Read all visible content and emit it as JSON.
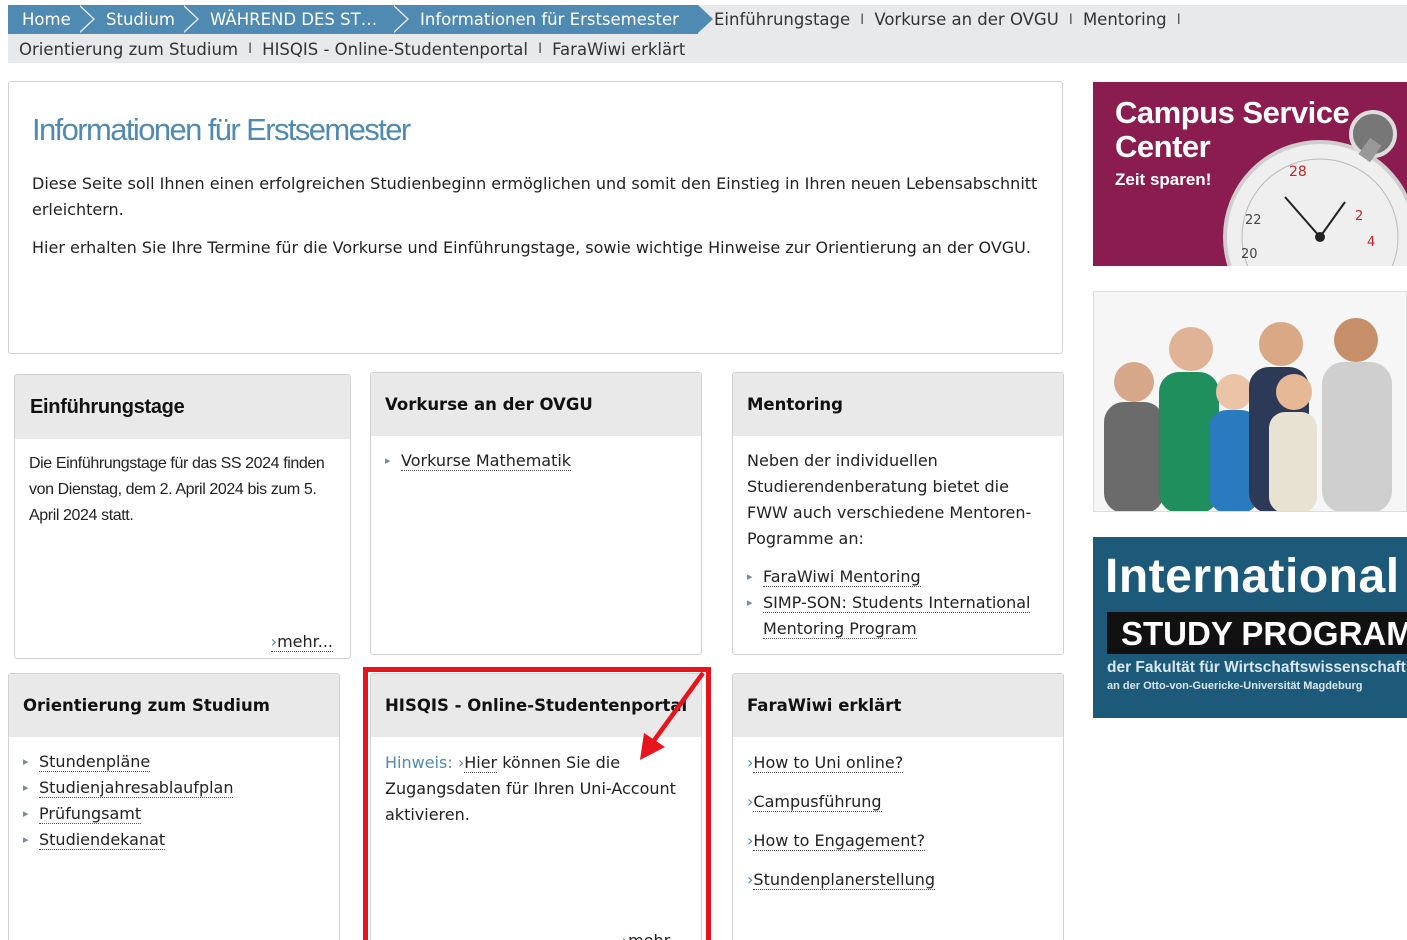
{
  "breadcrumb": {
    "crumbs": [
      "Home",
      "Studium",
      "WÄHREND DES ST…",
      "Informationen für Erstsemester"
    ],
    "links_row1": [
      "Einführungstage",
      "Vorkurse an der OVGU",
      "Mentoring"
    ],
    "links_row2": [
      "Orientierung zum Studium",
      "HISQIS - Online-Studentenportal",
      "FaraWiwi erklärt"
    ],
    "separator": "I"
  },
  "intro": {
    "title": "Informationen für Erstsemester",
    "p1": "Diese Seite soll Ihnen einen erfolgreichen Studienbeginn ermöglichen und somit den Einstieg in Ihren neuen Lebensabschnitt erleichtern.",
    "p2": "Hier erhalten Sie Ihre Termine für die Vorkurse und Einführungstage, sowie wichtige Hinweise zur Orientierung an der OVGU."
  },
  "boxes": {
    "einfuehrung": {
      "title": "Einführungstage",
      "text": "Die Einführungstage für das SS 2024 finden von Dienstag, dem 2. April 2024 bis zum 5. April 2024 statt.",
      "more": "mehr..."
    },
    "vorkurse": {
      "title": "Vorkurse an der OVGU",
      "items": [
        "Vorkurse Mathematik"
      ]
    },
    "mentoring": {
      "title": "Mentoring",
      "text": "Neben der individuellen Studierendenberatung bietet die FWW auch verschiedene Mentoren-Pogramme an:",
      "items": [
        "FaraWiwi Mentoring",
        "SIMP-SON: Students International Mentoring Program"
      ]
    },
    "orientierung": {
      "title": "Orientierung zum Studium",
      "items": [
        "Stundenpläne",
        "Studienjahresablaufplan",
        "Prüfungsamt",
        "Studiendekanat"
      ]
    },
    "hisqis": {
      "title": "HISQIS - Online-Studentenportal",
      "hint_label": "Hinweis:",
      "hint_link": "Hier",
      "hint_text": "können Sie die Zugangsdaten für Ihren Uni-Account aktivieren.",
      "more": "mehr..."
    },
    "farawiwi": {
      "title": "FaraWiwi erklärt",
      "items": [
        "How to Uni online?",
        "Campusführung",
        "How to Engagement?",
        "Stundenplanerstellung"
      ]
    }
  },
  "ads": {
    "csc": {
      "title_line1": "Campus Service",
      "title_line2": "Center",
      "subtitle": "Zeit sparen!",
      "dial_numbers": [
        "28",
        "2",
        "4",
        "20",
        "22"
      ]
    },
    "international": {
      "line1": "International",
      "line2": "STUDY PROGRAM",
      "line3": "der Fakultät für Wirtschaftswissenschaft",
      "line4": "an der Otto-von-Guericke-Universität Magdeburg"
    }
  },
  "colors": {
    "accent": "#4f8ab3",
    "annotation": "#e8141c",
    "csc": "#8b1c4f",
    "international": "#1d5a7a"
  }
}
